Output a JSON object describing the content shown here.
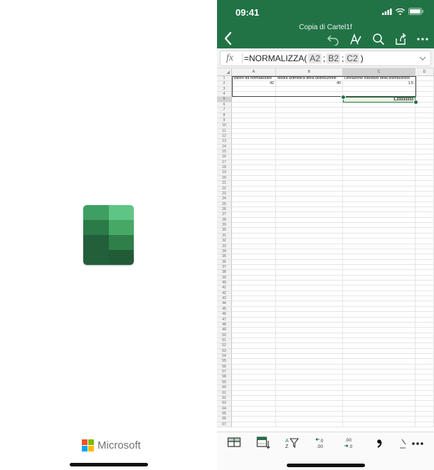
{
  "splash": {
    "app_logo": "excel-logo-icon",
    "brand": "Microsoft",
    "brand_colors": [
      "#f25022",
      "#7fba00",
      "#00a4ef",
      "#ffb900"
    ]
  },
  "phone": {
    "status": {
      "time": "09:41"
    },
    "doc_title": "Copia di Cartel1f",
    "accent_color": "#217346",
    "toolbar": {
      "back": "chevron-left-icon",
      "undo": "undo-icon",
      "format": "text-format-icon",
      "search": "search-icon",
      "share": "share-icon",
      "more": "more-icon"
    },
    "formula_bar": {
      "fx_label": "fx",
      "prefix": "=NORMALIZZA(",
      "arg1": "A2",
      "sep1": ";",
      "arg2": "B2",
      "sep2": ";",
      "arg3": "C2",
      "suffix": ")"
    },
    "columns": [
      "A",
      "B",
      "C",
      "D"
    ],
    "selected_column": "C",
    "selected_row": 5,
    "row_count": 67,
    "cells": {
      "A1": "Valore da normalizzare",
      "B1": "Media aritmetica della distribuzione",
      "C1": "Deviazione standard della distribuzione",
      "A2": "42",
      "B2": "40",
      "C2": "1,5",
      "C5": "1,33333333"
    },
    "bottom_toolbar": [
      "insert-table-icon",
      "freeze-panes-icon",
      "sort-filter-icon",
      "decrease-decimal-icon",
      "increase-decimal-icon",
      "comma-style-icon",
      "more-icon"
    ]
  }
}
